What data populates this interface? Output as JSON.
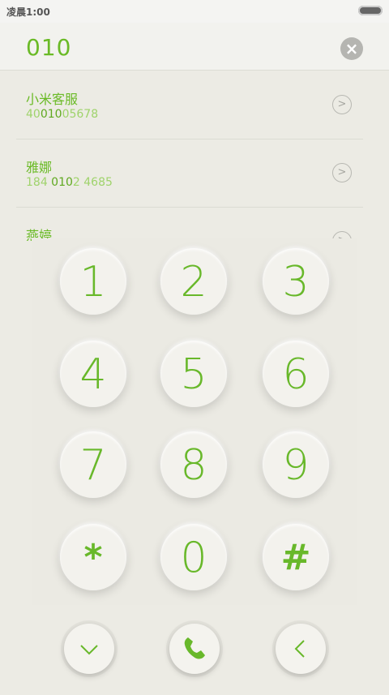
{
  "status": {
    "time": "凌晨1:00"
  },
  "dialer": {
    "number": "010",
    "clear_icon": "clear-icon"
  },
  "results": [
    {
      "name": "小米客服",
      "number_pre": "40",
      "number_hl": "010",
      "number_post": "05678"
    },
    {
      "name": "雅娜",
      "number_pre": "184 ",
      "number_hl": "010",
      "number_post": "2 4685"
    },
    {
      "name": "燕婷",
      "number_pre": "",
      "number_hl": "",
      "number_post": ""
    }
  ],
  "keypad": {
    "keys": [
      "1",
      "2",
      "3",
      "4",
      "5",
      "6",
      "7",
      "8",
      "9",
      "*",
      "0",
      "#"
    ]
  },
  "bottom": {
    "collapse_icon": "chevron-down-icon",
    "call_icon": "phone-icon",
    "back_icon": "chevron-left-icon"
  },
  "colors": {
    "accent": "#6aba26",
    "background": "#ecebe4"
  }
}
